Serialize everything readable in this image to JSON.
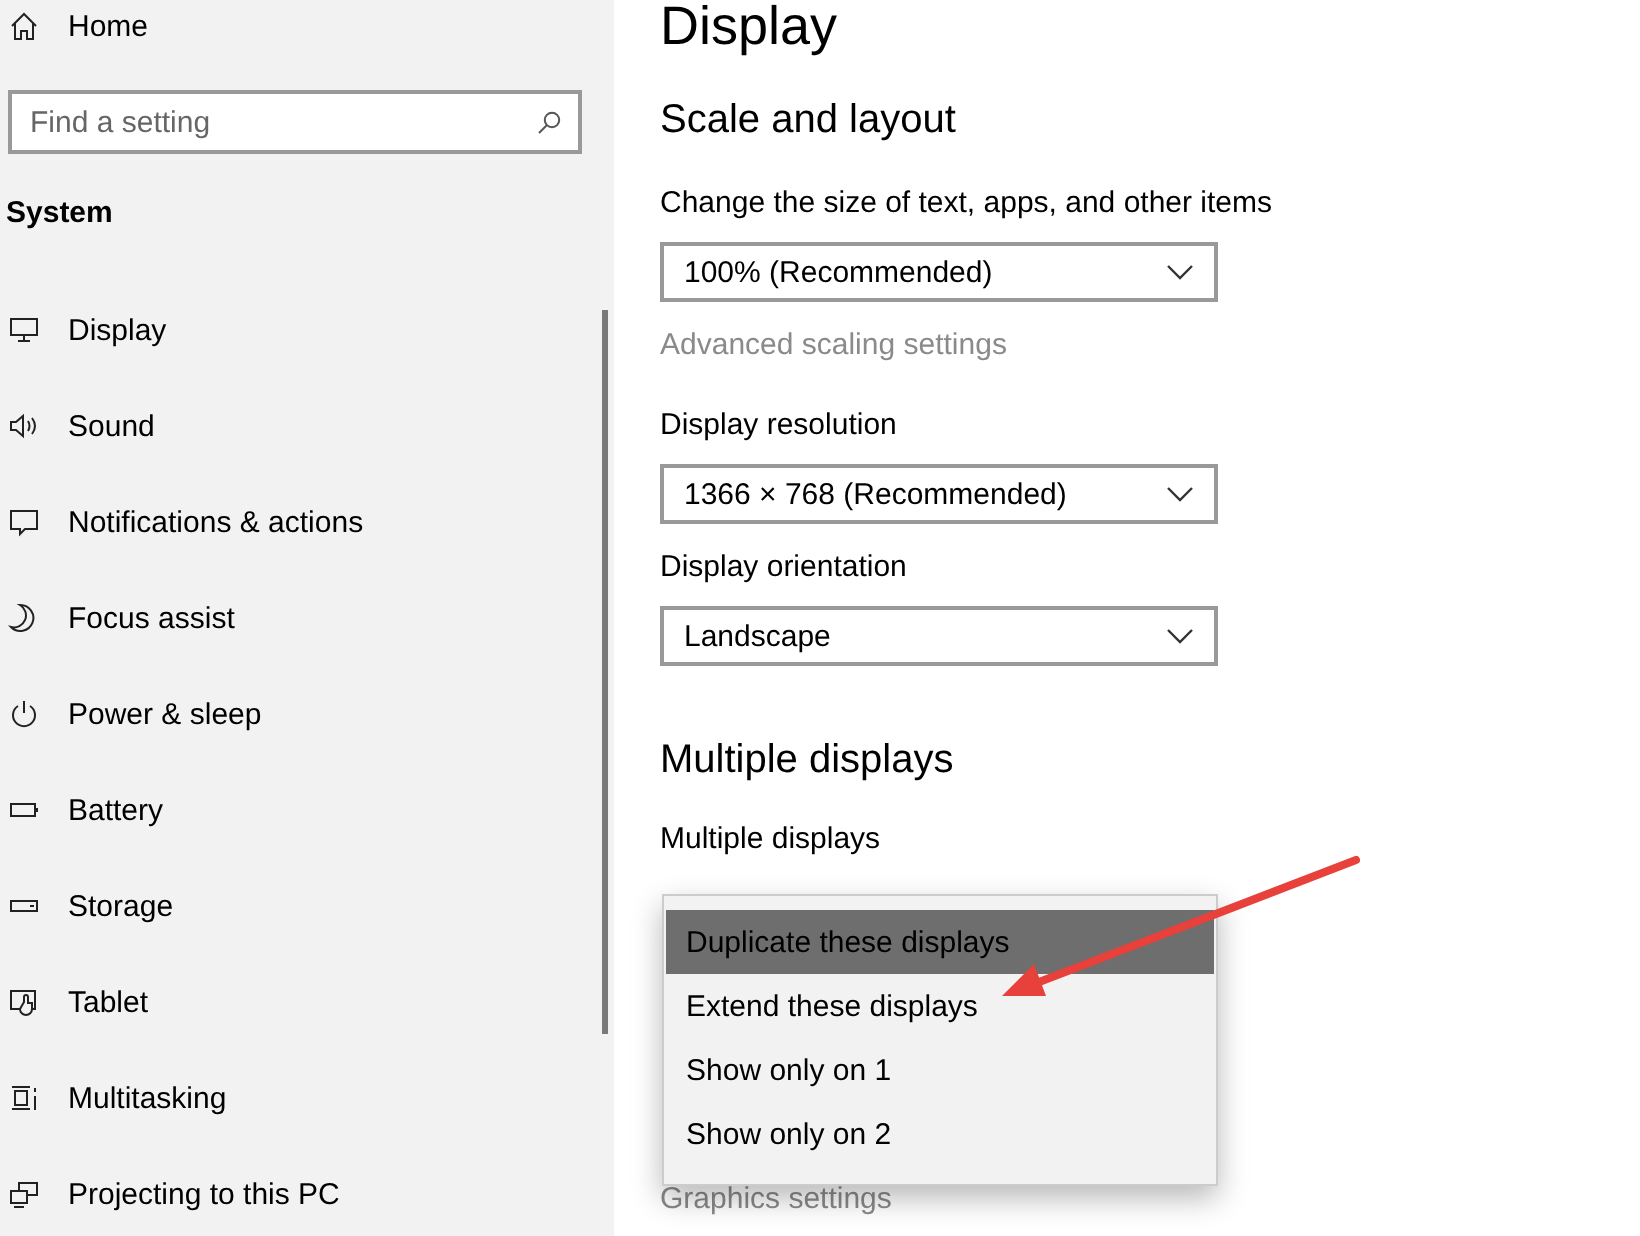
{
  "sidebar": {
    "home": "Home",
    "search": {
      "placeholder": "Find a setting"
    },
    "section": "System",
    "items": [
      {
        "label": "Display"
      },
      {
        "label": "Sound"
      },
      {
        "label": "Notifications & actions"
      },
      {
        "label": "Focus assist"
      },
      {
        "label": "Power & sleep"
      },
      {
        "label": "Battery"
      },
      {
        "label": "Storage"
      },
      {
        "label": "Tablet"
      },
      {
        "label": "Multitasking"
      },
      {
        "label": "Projecting to this PC"
      }
    ]
  },
  "page": {
    "title": "Display",
    "sections": [
      {
        "heading": "Scale and layout",
        "controls": [
          {
            "kind": "dropdown",
            "label": "Change the size of text, apps, and other items",
            "value": "100% (Recommended)"
          },
          {
            "kind": "link",
            "label": "Advanced scaling settings"
          },
          {
            "kind": "dropdown",
            "label": "Display resolution",
            "value": "1366 × 768 (Recommended)"
          },
          {
            "kind": "dropdown",
            "label": "Display orientation",
            "value": "Landscape"
          }
        ]
      },
      {
        "heading": "Multiple displays",
        "controls": [
          {
            "kind": "open-dropdown",
            "label": "Multiple displays",
            "options": [
              {
                "label": "Duplicate these displays",
                "selected": true
              },
              {
                "label": "Extend these displays",
                "selected": false
              },
              {
                "label": "Show only on 1",
                "selected": false
              },
              {
                "label": "Show only on 2",
                "selected": false
              }
            ]
          },
          {
            "kind": "link",
            "label": "Graphics settings"
          }
        ]
      }
    ]
  }
}
